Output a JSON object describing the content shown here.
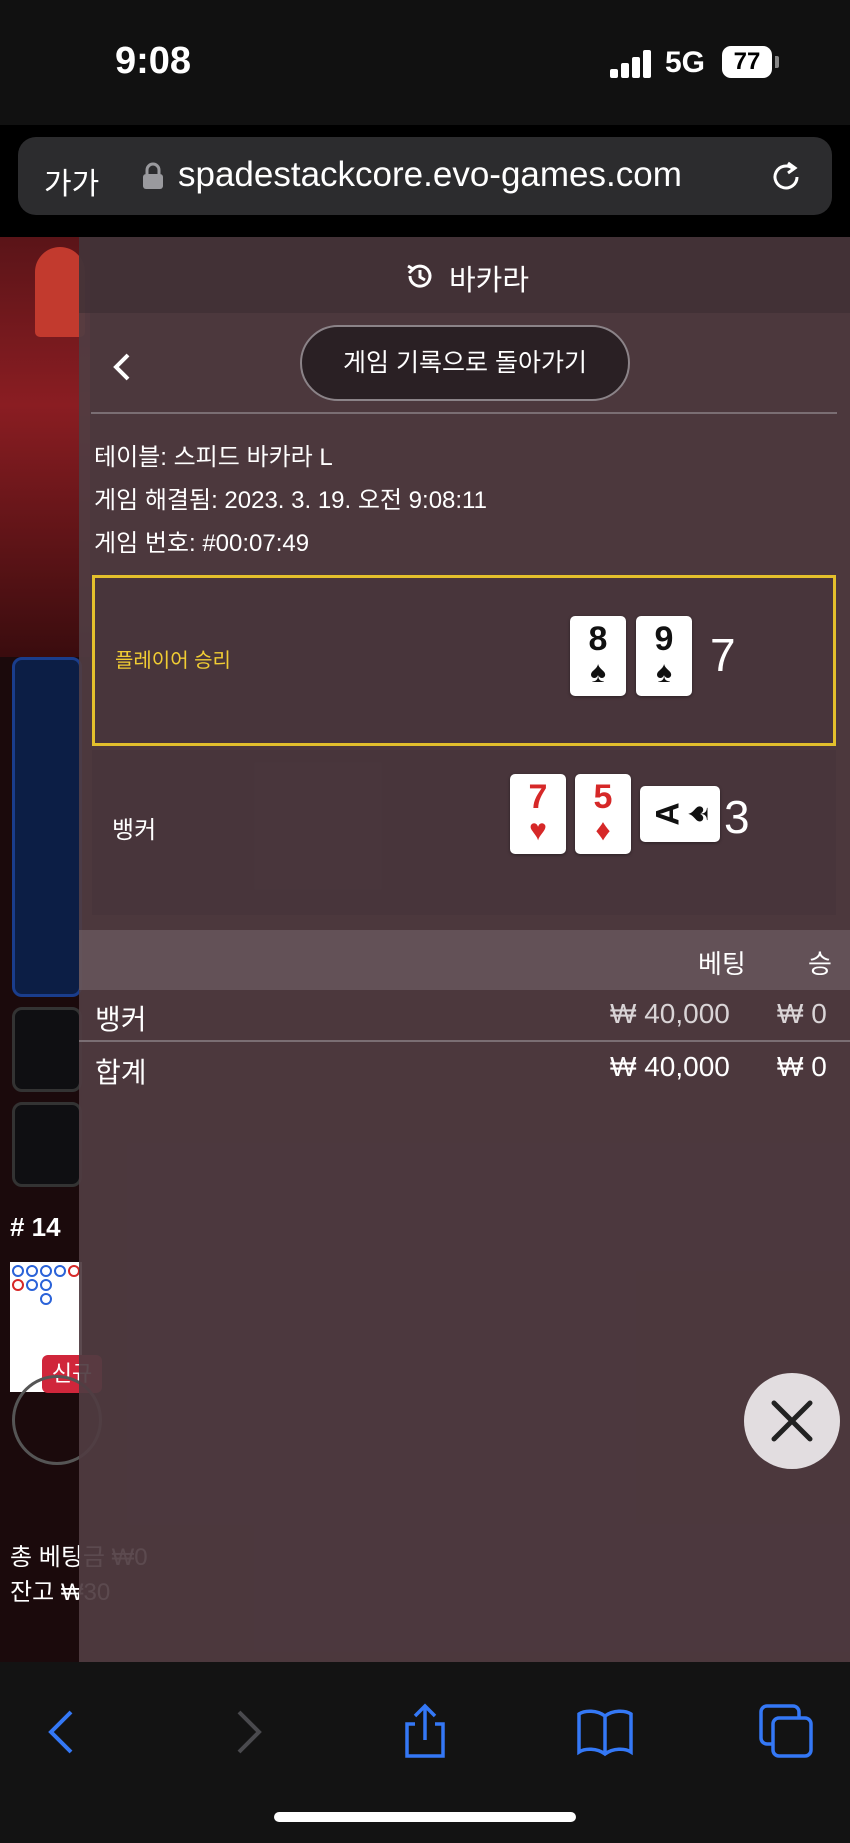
{
  "status_bar": {
    "time": "9:08",
    "network": "5G",
    "battery": "77"
  },
  "browser": {
    "text_size_label": "가가",
    "url": "spadestackcore.evo-games.com"
  },
  "background": {
    "round_label": "# 14",
    "badge": "신규",
    "total_bet": "총 베팅금 ₩0",
    "balance": "잔고 ₩30"
  },
  "panel": {
    "title": "바카라",
    "history_button": "게임 기록으로 돌아가기",
    "table_info": "테이블: 스피드 바카라 L",
    "resolved_info": "게임 해결됨: 2023. 3. 19. 오전 9:08:11",
    "game_number": "게임 번호: #00:07:49",
    "result": {
      "label": "플레이어 승리",
      "score": "7",
      "cards": [
        {
          "rank": "8",
          "suit": "♠",
          "color": "black"
        },
        {
          "rank": "9",
          "suit": "♠",
          "color": "black"
        }
      ]
    },
    "banker": {
      "label": "뱅커",
      "score": "3",
      "cards": [
        {
          "rank": "7",
          "suit": "♥",
          "color": "red"
        },
        {
          "rank": "5",
          "suit": "♦",
          "color": "red"
        },
        {
          "rank": "A",
          "suit": "♠",
          "color": "black",
          "orientation": "sideways"
        }
      ]
    },
    "bet_table": {
      "headers": {
        "bet": "베팅",
        "win": "승"
      },
      "rows": [
        {
          "name": "뱅커",
          "bet": "₩ 40,000",
          "win": "₩ 0"
        },
        {
          "name": "합계",
          "bet": "₩ 40,000",
          "win": "₩ 0"
        }
      ]
    }
  },
  "colors": {
    "winner_border": "#e3c02c",
    "red_card": "#d62828",
    "accent_blue": "#3478f6"
  },
  "icons": [
    "history-icon",
    "back-icon",
    "close-icon",
    "lock-icon",
    "reload-icon",
    "share-icon",
    "bookmarks-icon",
    "tabs-icon"
  ]
}
